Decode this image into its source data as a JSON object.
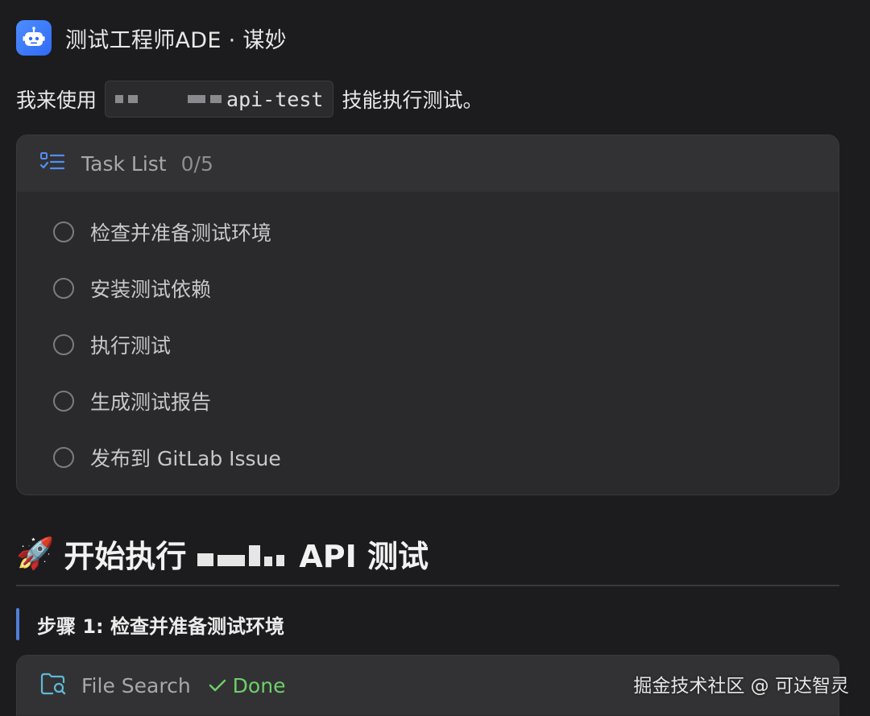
{
  "header": {
    "agent_name": "测试工程师ADE · 谋妙",
    "icon": "robot-icon"
  },
  "intro": {
    "prefix": "我来使用",
    "skill_name": "api-test",
    "suffix": "技能执行测试。"
  },
  "task_list": {
    "title": "Task List",
    "count": "0/5",
    "icon": "checklist-icon",
    "items": [
      {
        "label": "检查并准备测试环境",
        "done": false
      },
      {
        "label": "安装测试依赖",
        "done": false
      },
      {
        "label": "执行测试",
        "done": false
      },
      {
        "label": "生成测试报告",
        "done": false
      },
      {
        "label": "发布到 GitLab Issue",
        "done": false
      }
    ]
  },
  "section": {
    "emoji": "🚀",
    "prefix": "开始执行",
    "suffix": "API 测试"
  },
  "step": {
    "label": "步骤 1: 检查并准备测试环境"
  },
  "file_search": {
    "title": "File Search",
    "status": "Done",
    "icon": "folder-search-icon",
    "status_icon": "check-icon"
  },
  "watermark": "掘金技术社区 @ 可达智灵",
  "colors": {
    "background": "#1c1c1e",
    "card": "#2a2a2c",
    "accent_blue": "#4f7fd8",
    "done_green": "#6fcf6a"
  }
}
